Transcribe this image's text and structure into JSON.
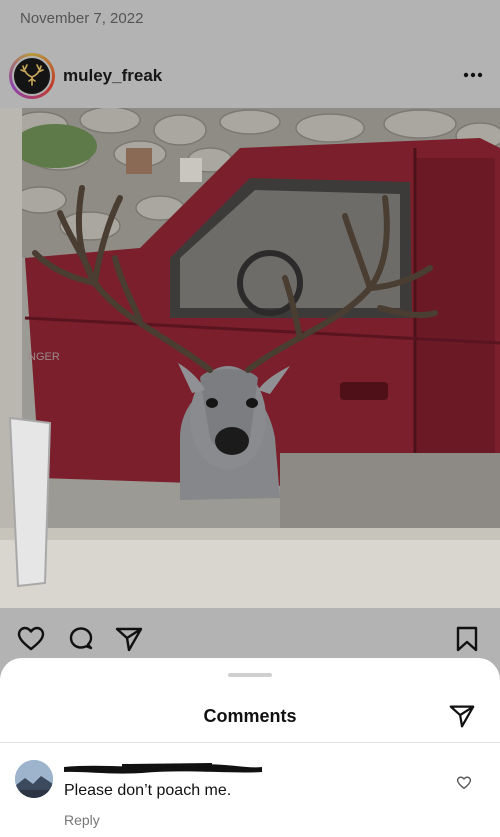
{
  "post": {
    "date": "November 7, 2022",
    "username": "muley_freak",
    "more_icon": "more-horizontal-icon",
    "photo_description_icon": "photo"
  },
  "actions": {
    "like_icon": "heart-icon",
    "comment_icon": "comment-icon",
    "share_icon": "send-icon",
    "save_icon": "bookmark-icon"
  },
  "comments_sheet": {
    "title": "Comments",
    "comments": [
      {
        "username": "[redacted]",
        "text": "Please don’t poach me.",
        "reply_label": "Reply"
      }
    ]
  },
  "colors": {
    "background": "#b3b3b3",
    "sheet": "#ffffff",
    "truck": "#7a1f2b"
  }
}
